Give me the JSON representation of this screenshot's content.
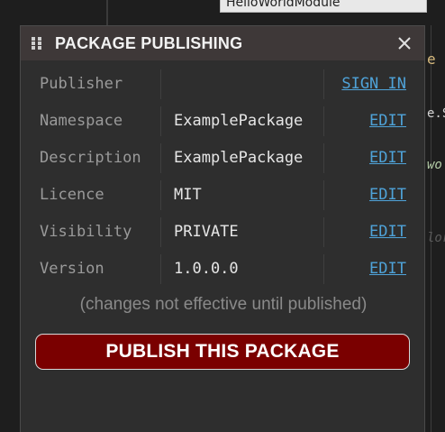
{
  "background": {
    "tab_label": "HelloWorldModule",
    "code_fragments": [
      "e",
      "e.S",
      "wo",
      "lor"
    ]
  },
  "panel": {
    "title": "PACKAGE PUBLISHING",
    "header_bg": "#3e3838",
    "properties": [
      {
        "label": "Publisher",
        "value": "",
        "action": "SIGN IN"
      },
      {
        "label": "Namespace",
        "value": "ExamplePackage",
        "action": "EDIT"
      },
      {
        "label": "Description",
        "value": "ExamplePackage",
        "action": "EDIT"
      },
      {
        "label": "Licence",
        "value": "MIT",
        "action": "EDIT"
      },
      {
        "label": "Visibility",
        "value": "PRIVATE",
        "action": "EDIT"
      },
      {
        "label": "Version",
        "value": "1.0.0.0",
        "action": "EDIT"
      }
    ],
    "note": "(changes not effective until published)",
    "publish_label": "PUBLISH THIS PACKAGE",
    "publish_color": "#7a0000",
    "link_color": "#4fa3d9"
  }
}
